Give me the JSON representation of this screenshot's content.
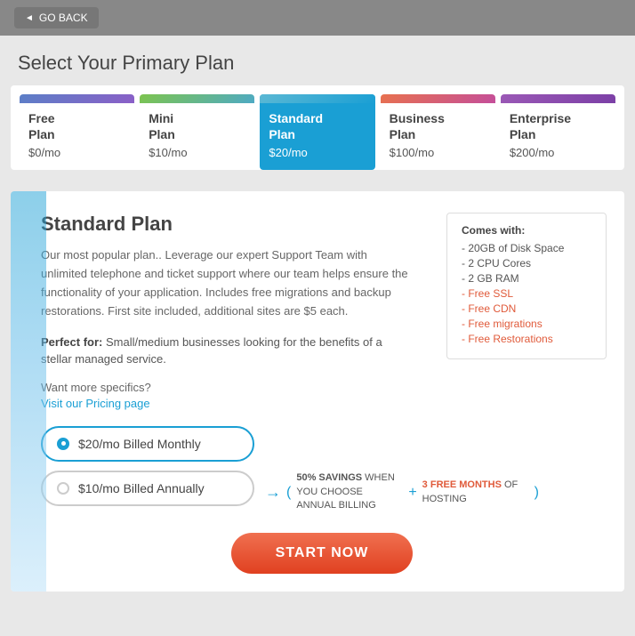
{
  "topbar": {
    "go_back_label": "GO BACK"
  },
  "page": {
    "title": "Select Your Primary Plan"
  },
  "plans": [
    {
      "id": "free",
      "name": "Free\nPlan",
      "price": "$0/mo",
      "header_class": "header-free",
      "active": false
    },
    {
      "id": "mini",
      "name": "Mini\nPlan",
      "price": "$10/mo",
      "header_class": "header-mini",
      "active": false
    },
    {
      "id": "standard",
      "name": "Standard\nPlan",
      "price": "$20/mo",
      "header_class": "header-standard",
      "active": true
    },
    {
      "id": "business",
      "name": "Business\nPlan",
      "price": "$100/mo",
      "header_class": "header-business",
      "active": false
    },
    {
      "id": "enterprise",
      "name": "Enterprise\nPlan",
      "price": "$200/mo",
      "header_class": "header-enterprise",
      "active": false
    }
  ],
  "detail": {
    "title": "Standard Plan",
    "description": "Our most popular plan.. Leverage our expert Support Team with unlimited telephone and ticket support where our team helps ensure the functionality of your application. Includes free migrations and backup restorations. First site included, additional sites are $5 each.",
    "perfect_for_label": "Perfect for:",
    "perfect_for_text": "Small/medium businesses looking for the benefits of a stellar managed service.",
    "want_more": "Want more specifics?",
    "pricing_link": "Visit our Pricing page",
    "comes_with": {
      "title": "Comes with:",
      "items": [
        {
          "text": "- 20GB of Disk Space",
          "red": false
        },
        {
          "text": "- 2 CPU Cores",
          "red": false
        },
        {
          "text": "- 2 GB RAM",
          "red": false
        },
        {
          "text": "- Free SSL",
          "red": true
        },
        {
          "text": "- Free CDN",
          "red": true
        },
        {
          "text": "- Free migrations",
          "red": true
        },
        {
          "text": "- Free Restorations",
          "red": true
        }
      ]
    }
  },
  "billing": {
    "monthly": {
      "label": "$20/mo Billed Monthly",
      "selected": true
    },
    "annual": {
      "label": "$10/mo Billed Annually",
      "selected": false
    },
    "savings": {
      "percent": "50% SAVINGS",
      "when": "WHEN YOU CHOOSE ANNUAL BILLING",
      "free_months": "3 FREE MONTHS",
      "of_hosting": "OF HOSTING"
    }
  },
  "cta": {
    "label": "START NOW"
  }
}
